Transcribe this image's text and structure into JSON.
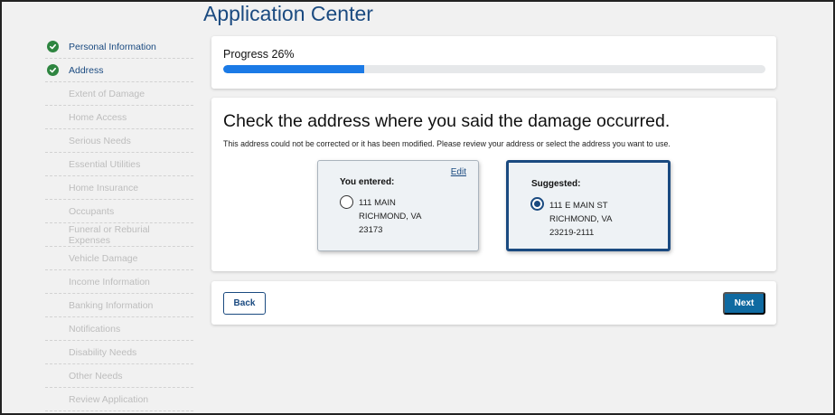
{
  "page": {
    "title": "Application Center"
  },
  "sidebar": {
    "steps": [
      {
        "label": "Personal Information",
        "status": "done"
      },
      {
        "label": "Address",
        "status": "done"
      },
      {
        "label": "Extent of Damage",
        "status": "pending"
      },
      {
        "label": "Home Access",
        "status": "pending"
      },
      {
        "label": "Serious Needs",
        "status": "pending"
      },
      {
        "label": "Essential Utilities",
        "status": "pending"
      },
      {
        "label": "Home Insurance",
        "status": "pending"
      },
      {
        "label": "Occupants",
        "status": "pending"
      },
      {
        "label": "Funeral or Reburial Expenses",
        "status": "pending"
      },
      {
        "label": "Vehicle Damage",
        "status": "pending"
      },
      {
        "label": "Income Information",
        "status": "pending"
      },
      {
        "label": "Banking Information",
        "status": "pending"
      },
      {
        "label": "Notifications",
        "status": "pending"
      },
      {
        "label": "Disability Needs",
        "status": "pending"
      },
      {
        "label": "Other Needs",
        "status": "pending"
      },
      {
        "label": "Review Application",
        "status": "pending"
      }
    ]
  },
  "progress": {
    "label": "Progress 26%",
    "percent": 26
  },
  "address_check": {
    "heading": "Check the address where you said the damage occurred.",
    "subtext": "This address could not be corrected or it has been modified. Please review your address or select the address you want to use.",
    "entered": {
      "title": "You entered:",
      "edit_label": "Edit",
      "line1": "111 MAIN",
      "line2": "RICHMOND, VA",
      "line3": "23173",
      "selected": false
    },
    "suggested": {
      "title": "Suggested:",
      "line1": "111 E MAIN ST",
      "line2": "RICHMOND, VA",
      "line3": "23219-2111",
      "selected": true
    }
  },
  "nav": {
    "back_label": "Back",
    "next_label": "Next"
  },
  "colors": {
    "brand": "#1a4a80",
    "progress_fill": "#1b7ae6",
    "check": "#2e8540",
    "next_button": "#0f6aa1"
  }
}
